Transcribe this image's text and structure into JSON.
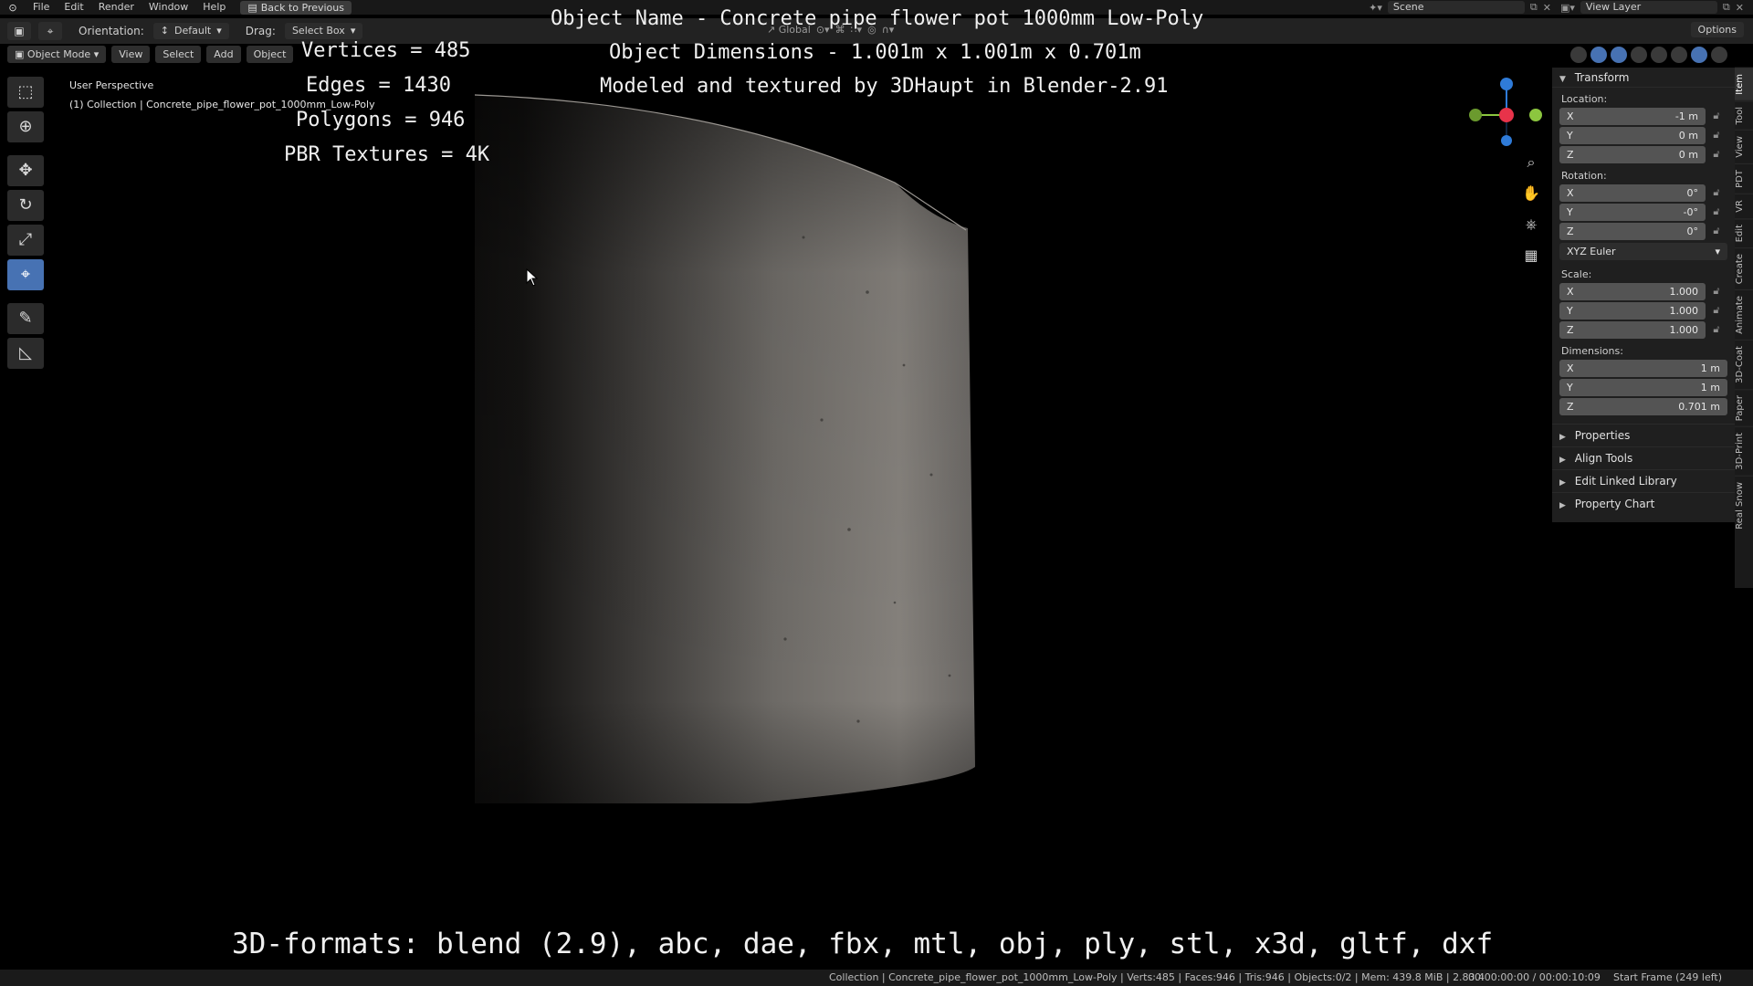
{
  "menubar": {
    "items": [
      "File",
      "Edit",
      "Render",
      "Window",
      "Help"
    ],
    "back_label": "Back to Previous",
    "scene": "Scene",
    "view_layer": "View Layer"
  },
  "toolheader": {
    "orientation_label": "Orientation:",
    "orientation_value": "Default",
    "drag_label": "Drag:",
    "drag_value": "Select Box",
    "transform_space": "Global",
    "options": "Options"
  },
  "viewport_header": {
    "mode": "Object Mode",
    "menus": [
      "View",
      "Select",
      "Add",
      "Object"
    ]
  },
  "viewport": {
    "perspective": "User Perspective",
    "collection": "(1) Collection | Concrete_pipe_flower_pot_1000mm_Low-Poly"
  },
  "overlay": {
    "vertices": "Vertices = 485",
    "edges": "Edges = 1430",
    "polygons": "Polygons = 946",
    "textures": "PBR Textures = 4K",
    "object_name": "Object Name - Concrete pipe flower pot 1000mm Low-Poly",
    "dimensions": "Object Dimensions -  1.001m x 1.001m x 0.701m",
    "credits": "Modeled and textured by 3DHaupt in Blender-2.91",
    "formats": "3D-formats: blend (2.9), abc, dae, fbx, mtl, obj, ply, stl, x3d, gltf, dxf"
  },
  "sidebar": {
    "transform": "Transform",
    "location_label": "Location:",
    "location": [
      {
        "axis": "X",
        "value": "-1 m"
      },
      {
        "axis": "Y",
        "value": "0 m"
      },
      {
        "axis": "Z",
        "value": "0 m"
      }
    ],
    "rotation_label": "Rotation:",
    "rotation": [
      {
        "axis": "X",
        "value": "0°"
      },
      {
        "axis": "Y",
        "value": "-0°"
      },
      {
        "axis": "Z",
        "value": "0°"
      }
    ],
    "rotation_mode": "XYZ Euler",
    "scale_label": "Scale:",
    "scale": [
      {
        "axis": "X",
        "value": "1.000"
      },
      {
        "axis": "Y",
        "value": "1.000"
      },
      {
        "axis": "Z",
        "value": "1.000"
      }
    ],
    "dimensions_label": "Dimensions:",
    "dimensions": [
      {
        "axis": "X",
        "value": "1 m"
      },
      {
        "axis": "Y",
        "value": "1 m"
      },
      {
        "axis": "Z",
        "value": "0.701 m"
      }
    ],
    "subpanels": [
      "Properties",
      "Align Tools",
      "Edit Linked Library",
      "Property Chart"
    ]
  },
  "tabs": [
    "Item",
    "Tool",
    "View",
    "PDT",
    "VR",
    "Edit",
    "Create",
    "Animate",
    "3D-Coat",
    "Paper",
    "3D-Print",
    "Real Snow"
  ],
  "statusbar": {
    "info": "Collection | Concrete_pipe_flower_pot_1000mm_Low-Poly | Verts:485 | Faces:946 | Tris:946 | Objects:0/2 | Mem: 439.8 MiB | 2.83.4",
    "time": "00:00:00:00 / 00:00:10:09",
    "frame": "Start Frame (249 left)"
  },
  "colors": {
    "active_tool": "#4772b3",
    "axis_x": "#e8334a",
    "axis_y": "#8cc63f",
    "axis_z": "#2f7bd8"
  }
}
